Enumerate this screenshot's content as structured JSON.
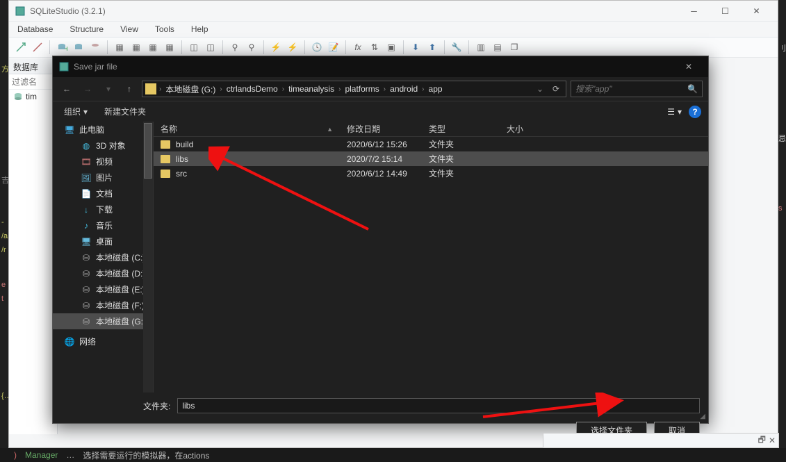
{
  "app": {
    "title": "SQLiteStudio (3.2.1)"
  },
  "menu": {
    "items": [
      "Database",
      "Structure",
      "View",
      "Tools",
      "Help"
    ]
  },
  "sidepanel": {
    "title": "数据库",
    "filter_placeholder": "过滤名",
    "db_item": "tim"
  },
  "dialog": {
    "title": "Save jar file",
    "breadcrumb": [
      "本地磁盘 (G:)",
      "ctrlandsDemo",
      "timeanalysis",
      "platforms",
      "android",
      "app"
    ],
    "search_placeholder": "搜索\"app\"",
    "organize": "组织",
    "new_folder": "新建文件夹",
    "columns": {
      "name": "名称",
      "date": "修改日期",
      "type": "类型",
      "size": "大小"
    },
    "rows": [
      {
        "name": "build",
        "date": "2020/6/12 15:26",
        "type": "文件夹",
        "selected": false
      },
      {
        "name": "libs",
        "date": "2020/7/2 15:14",
        "type": "文件夹",
        "selected": true
      },
      {
        "name": "src",
        "date": "2020/6/12 14:49",
        "type": "文件夹",
        "selected": false
      }
    ],
    "tree": {
      "this_pc": "此电脑",
      "items": [
        {
          "label": "3D 对象",
          "icon": "3d"
        },
        {
          "label": "视频",
          "icon": "video"
        },
        {
          "label": "图片",
          "icon": "pictures"
        },
        {
          "label": "文档",
          "icon": "docs"
        },
        {
          "label": "下载",
          "icon": "download"
        },
        {
          "label": "音乐",
          "icon": "music"
        },
        {
          "label": "桌面",
          "icon": "desktop"
        },
        {
          "label": "本地磁盘 (C:)",
          "icon": "disk"
        },
        {
          "label": "本地磁盘 (D:)",
          "icon": "disk"
        },
        {
          "label": "本地磁盘 (E:)",
          "icon": "disk"
        },
        {
          "label": "本地磁盘 (F:)",
          "icon": "disk"
        },
        {
          "label": "本地磁盘 (G:)",
          "icon": "disk",
          "selected": true
        }
      ],
      "network": "网络"
    },
    "folder_label": "文件夹:",
    "folder_value": "libs",
    "select_btn": "选择文件夹",
    "cancel_btn": "取消"
  },
  "bottom_strip": "选择需要运行的模拟器，在actions"
}
